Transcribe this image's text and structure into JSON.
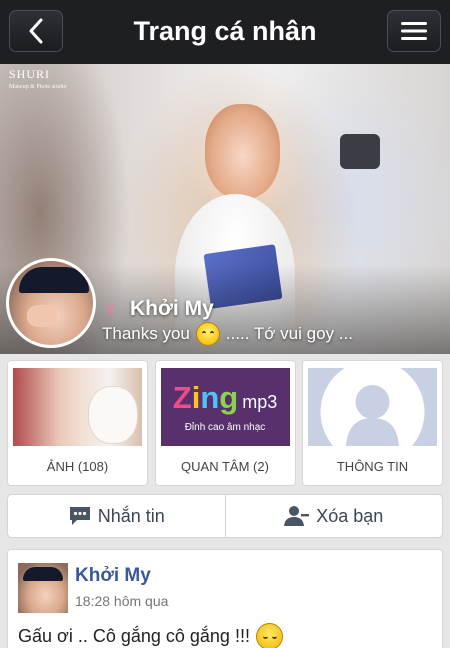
{
  "header": {
    "title": "Trang cá nhân",
    "back_icon": "back-chevron-icon",
    "menu_icon": "hamburger-menu-icon"
  },
  "cover": {
    "brand_logo": "SHURI",
    "brand_sub": "Makeup & Photo studio"
  },
  "profile": {
    "name": "Khởi My",
    "gender_symbol": "♀",
    "gender_color": "#ff6fb5",
    "status_before": "Thanks you",
    "status_emoji": "smiling-emoji-icon",
    "status_after": "..... Tớ vui goy ..."
  },
  "tiles": [
    {
      "label": "ẢNH (108)",
      "icon": "photo-thumbnail"
    },
    {
      "label": "QUAN TÂM (2)",
      "icon": "zing-mp3-logo",
      "logo_zing": "Zing",
      "logo_mp3": "mp3",
      "logo_tagline": "Đỉnh cao âm nhạc"
    },
    {
      "label": "THÔNG TIN",
      "icon": "person-silhouette-icon"
    }
  ],
  "actions": {
    "message_label": "Nhắn tin",
    "message_icon": "chat-bubble-icon",
    "unfriend_label": "Xóa bạn",
    "unfriend_icon": "remove-user-icon"
  },
  "post": {
    "author": "Khởi My",
    "time": "18:28 hôm qua",
    "text": "Gấu ơi .. Cô gắng cô gắng !!!",
    "emoji": "pleased-emoji-icon"
  },
  "colors": {
    "header_bg": "#1d1f22",
    "link_blue": "#3b5998",
    "page_bg": "#e6e6e6"
  }
}
